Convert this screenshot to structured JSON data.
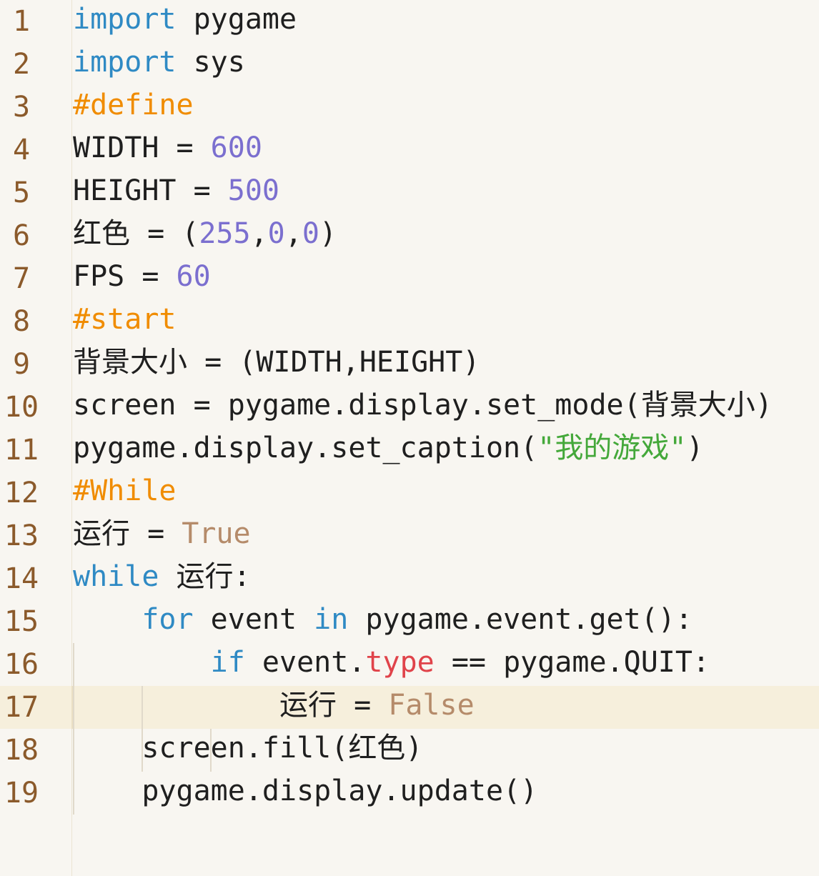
{
  "editor": {
    "lines": [
      {
        "num": "1",
        "tokens": [
          {
            "t": "import",
            "c": "kw"
          },
          {
            "t": " pygame"
          }
        ]
      },
      {
        "num": "2",
        "tokens": [
          {
            "t": "import",
            "c": "kw"
          },
          {
            "t": " sys"
          }
        ]
      },
      {
        "num": "3",
        "tokens": [
          {
            "t": "#define",
            "c": "cm"
          }
        ]
      },
      {
        "num": "4",
        "tokens": [
          {
            "t": "WIDTH = "
          },
          {
            "t": "600",
            "c": "num"
          }
        ]
      },
      {
        "num": "5",
        "tokens": [
          {
            "t": "HEIGHT = "
          },
          {
            "t": "500",
            "c": "num"
          }
        ]
      },
      {
        "num": "6",
        "tokens": [
          {
            "t": "红色",
            "c": "cjk"
          },
          {
            "t": " = ("
          },
          {
            "t": "255",
            "c": "num"
          },
          {
            "t": ","
          },
          {
            "t": "0",
            "c": "num"
          },
          {
            "t": ","
          },
          {
            "t": "0",
            "c": "num"
          },
          {
            "t": ")"
          }
        ]
      },
      {
        "num": "7",
        "tokens": [
          {
            "t": "FPS = "
          },
          {
            "t": "60",
            "c": "num"
          }
        ]
      },
      {
        "num": "8",
        "tokens": [
          {
            "t": "#start",
            "c": "cm"
          }
        ]
      },
      {
        "num": "9",
        "tokens": [
          {
            "t": "背景大小",
            "c": "cjk"
          },
          {
            "t": " = (WIDTH,HEIGHT)"
          }
        ]
      },
      {
        "num": "10",
        "tokens": [
          {
            "t": "screen = pygame.display.set_mode("
          },
          {
            "t": "背景大小",
            "c": "cjk"
          },
          {
            "t": ")"
          }
        ]
      },
      {
        "num": "11",
        "tokens": [
          {
            "t": "pygame.display.set_caption("
          },
          {
            "t": "\"",
            "c": "str"
          },
          {
            "t": "我的游戏",
            "c": "str cjk"
          },
          {
            "t": "\"",
            "c": "str"
          },
          {
            "t": ")"
          }
        ]
      },
      {
        "num": "12",
        "tokens": [
          {
            "t": "#While",
            "c": "cm"
          }
        ]
      },
      {
        "num": "13",
        "tokens": [
          {
            "t": "运行",
            "c": "cjk"
          },
          {
            "t": " = "
          },
          {
            "t": "True",
            "c": "const"
          }
        ]
      },
      {
        "num": "14",
        "tokens": [
          {
            "t": "while",
            "c": "kw"
          },
          {
            "t": " "
          },
          {
            "t": "运行",
            "c": "cjk"
          },
          {
            "t": ":"
          }
        ]
      },
      {
        "num": "15",
        "tokens": [
          {
            "t": "    "
          },
          {
            "t": "for",
            "c": "kw"
          },
          {
            "t": " event "
          },
          {
            "t": "in",
            "c": "kw"
          },
          {
            "t": " pygame.event.get():"
          }
        ]
      },
      {
        "num": "16",
        "tokens": [
          {
            "t": "        "
          },
          {
            "t": "if",
            "c": "kw"
          },
          {
            "t": " event."
          },
          {
            "t": "type",
            "c": "attr"
          },
          {
            "t": " == pygame.QUIT:"
          }
        ]
      },
      {
        "num": "17",
        "current": true,
        "tokens": [
          {
            "t": "            "
          },
          {
            "t": "运行",
            "c": "cjk"
          },
          {
            "t": " = "
          },
          {
            "t": "False",
            "c": "const"
          }
        ]
      },
      {
        "num": "18",
        "tokens": [
          {
            "t": "    screen.fill("
          },
          {
            "t": "红色",
            "c": "cjk"
          },
          {
            "t": ")"
          }
        ]
      },
      {
        "num": "19",
        "tokens": [
          {
            "t": "    pygame.display.update()"
          }
        ]
      }
    ]
  }
}
